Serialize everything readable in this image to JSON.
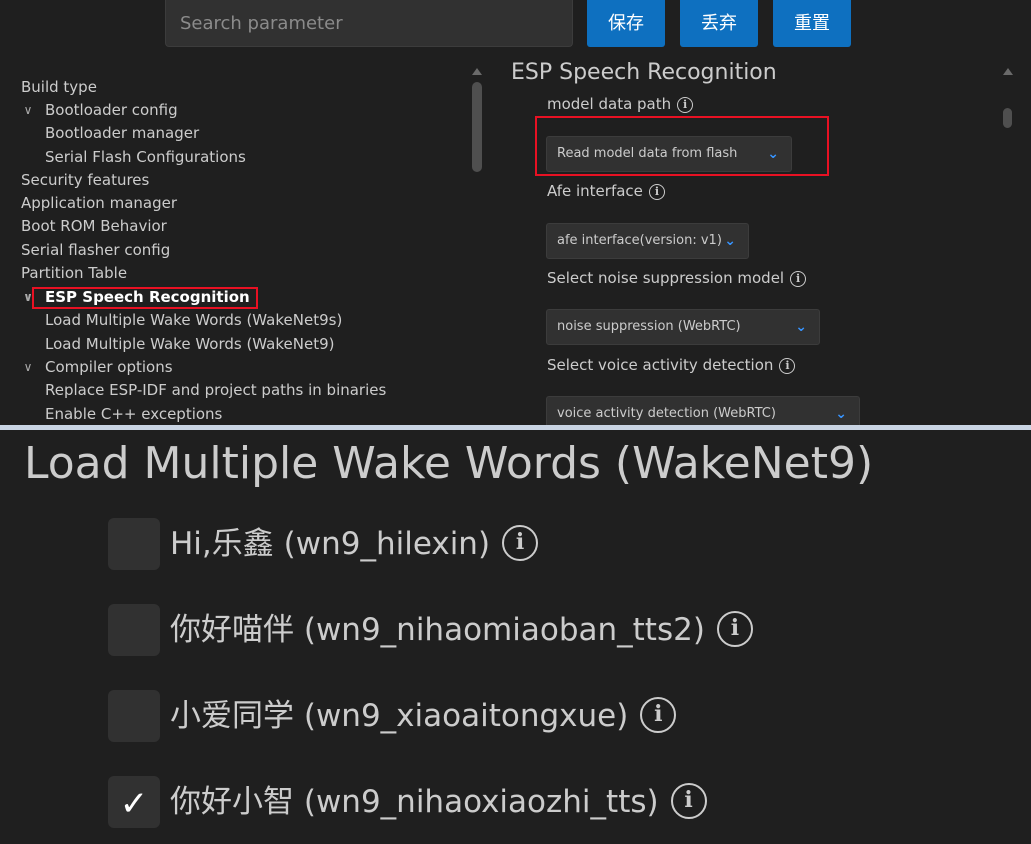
{
  "toolbar": {
    "search_placeholder": "Search parameter",
    "save_label": "保存",
    "discard_label": "丢弃",
    "reset_label": "重置"
  },
  "tree": {
    "items": [
      {
        "label": "Build type",
        "level": 0,
        "expanded": null
      },
      {
        "label": "Bootloader config",
        "level": 1,
        "expanded": true
      },
      {
        "label": "Bootloader manager",
        "level": 1,
        "expanded": null
      },
      {
        "label": "Serial Flash Configurations",
        "level": 1,
        "expanded": null
      },
      {
        "label": "Security features",
        "level": 0,
        "expanded": null
      },
      {
        "label": "Application manager",
        "level": 0,
        "expanded": null
      },
      {
        "label": "Boot ROM Behavior",
        "level": 0,
        "expanded": null
      },
      {
        "label": "Serial flasher config",
        "level": 0,
        "expanded": null
      },
      {
        "label": "Partition Table",
        "level": 0,
        "expanded": null
      },
      {
        "label": "ESP Speech Recognition",
        "level": 1,
        "expanded": true,
        "selected": true
      },
      {
        "label": "Load Multiple Wake Words (WakeNet9s)",
        "level": 1,
        "expanded": null
      },
      {
        "label": "Load Multiple Wake Words (WakeNet9)",
        "level": 1,
        "expanded": null
      },
      {
        "label": "Compiler options",
        "level": 1,
        "expanded": true
      },
      {
        "label": "Replace ESP-IDF and project paths in binaries",
        "level": 1,
        "expanded": null
      },
      {
        "label": "Enable C++ exceptions",
        "level": 1,
        "expanded": null
      }
    ]
  },
  "settings": {
    "title": "ESP Speech Recognition",
    "model_path": {
      "label": "model data path",
      "value": "Read model data from flash"
    },
    "afe": {
      "label": "Afe interface",
      "value": "afe interface(version: v1)"
    },
    "noise": {
      "label": "Select noise suppression model",
      "value": "noise suppression (WebRTC)"
    },
    "vad": {
      "label": "Select voice activity detection",
      "value": "voice activity detection (WebRTC)"
    }
  },
  "zoom": {
    "title": "Load Multiple Wake Words (WakeNet9)",
    "options": [
      {
        "label": "Hi,乐鑫 (wn9_hilexin)",
        "checked": false
      },
      {
        "label": "你好喵伴 (wn9_nihaomiaoban_tts2)",
        "checked": false
      },
      {
        "label": "小爱同学 (wn9_xiaoaitongxue)",
        "checked": false
      },
      {
        "label": "你好小智 (wn9_nihaoxiaozhi_tts)",
        "checked": true
      }
    ]
  },
  "colors": {
    "accent": "#0e70c0",
    "highlight": "#e81123",
    "background": "#1f1f1f"
  }
}
